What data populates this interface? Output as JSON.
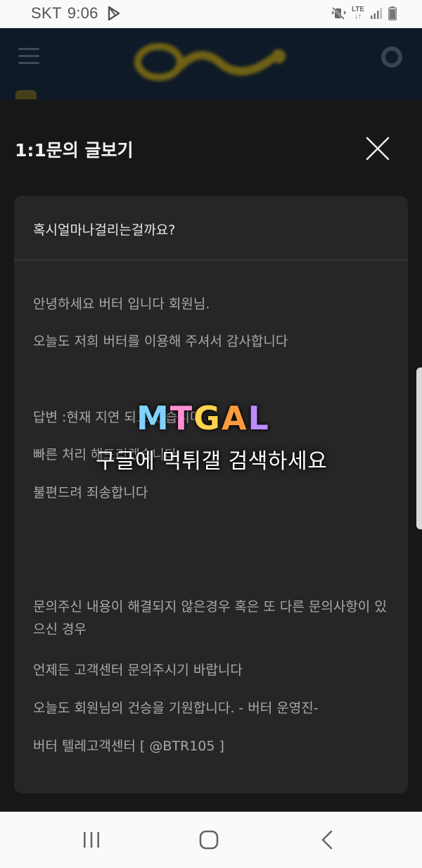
{
  "status_bar": {
    "carrier": "SKT",
    "time": "9:06",
    "network": "LTE"
  },
  "sheet": {
    "title": "1:1문의 글보기",
    "close_icon": "close-icon"
  },
  "inquiry": {
    "subject": "혹시얼마나걸리는걸까요?",
    "reply_lines": [
      "안녕하세요 버터 입니다 회원님.",
      "오늘도 저희 버터를 이용해 주셔서 감사합니다",
      "답변 :현재 지연 되고 있습니다",
      "빠른 처리 해드리겠습니다",
      "불편드려 죄송합니다",
      "문의주신 내용이 해결되지 않은경우 혹은 또 다른 문의사항이 있으신 경우",
      "언제든 고객센터 문의주시기 바랍니다",
      "오늘도 회원님의 건승을 기원합니다. - 버터 운영진-",
      "버터 텔레고객센터 [ @BTR105 ]"
    ]
  },
  "watermark": {
    "logo": "MTGAL",
    "text": "구글에 먹튀갤 검색하세요",
    "colors": [
      "#7fd1ff",
      "#ff8fd2",
      "#ffd34d",
      "#ff9a3c",
      "#b98cff"
    ]
  },
  "navbar": {
    "icons": [
      "recent-apps-icon",
      "home-icon",
      "back-icon"
    ]
  },
  "colors": {
    "sheet_bg": "#171717",
    "card_bg": "#262626",
    "text_primary": "#e8e8e8",
    "text_secondary": "#a9a9a9"
  }
}
